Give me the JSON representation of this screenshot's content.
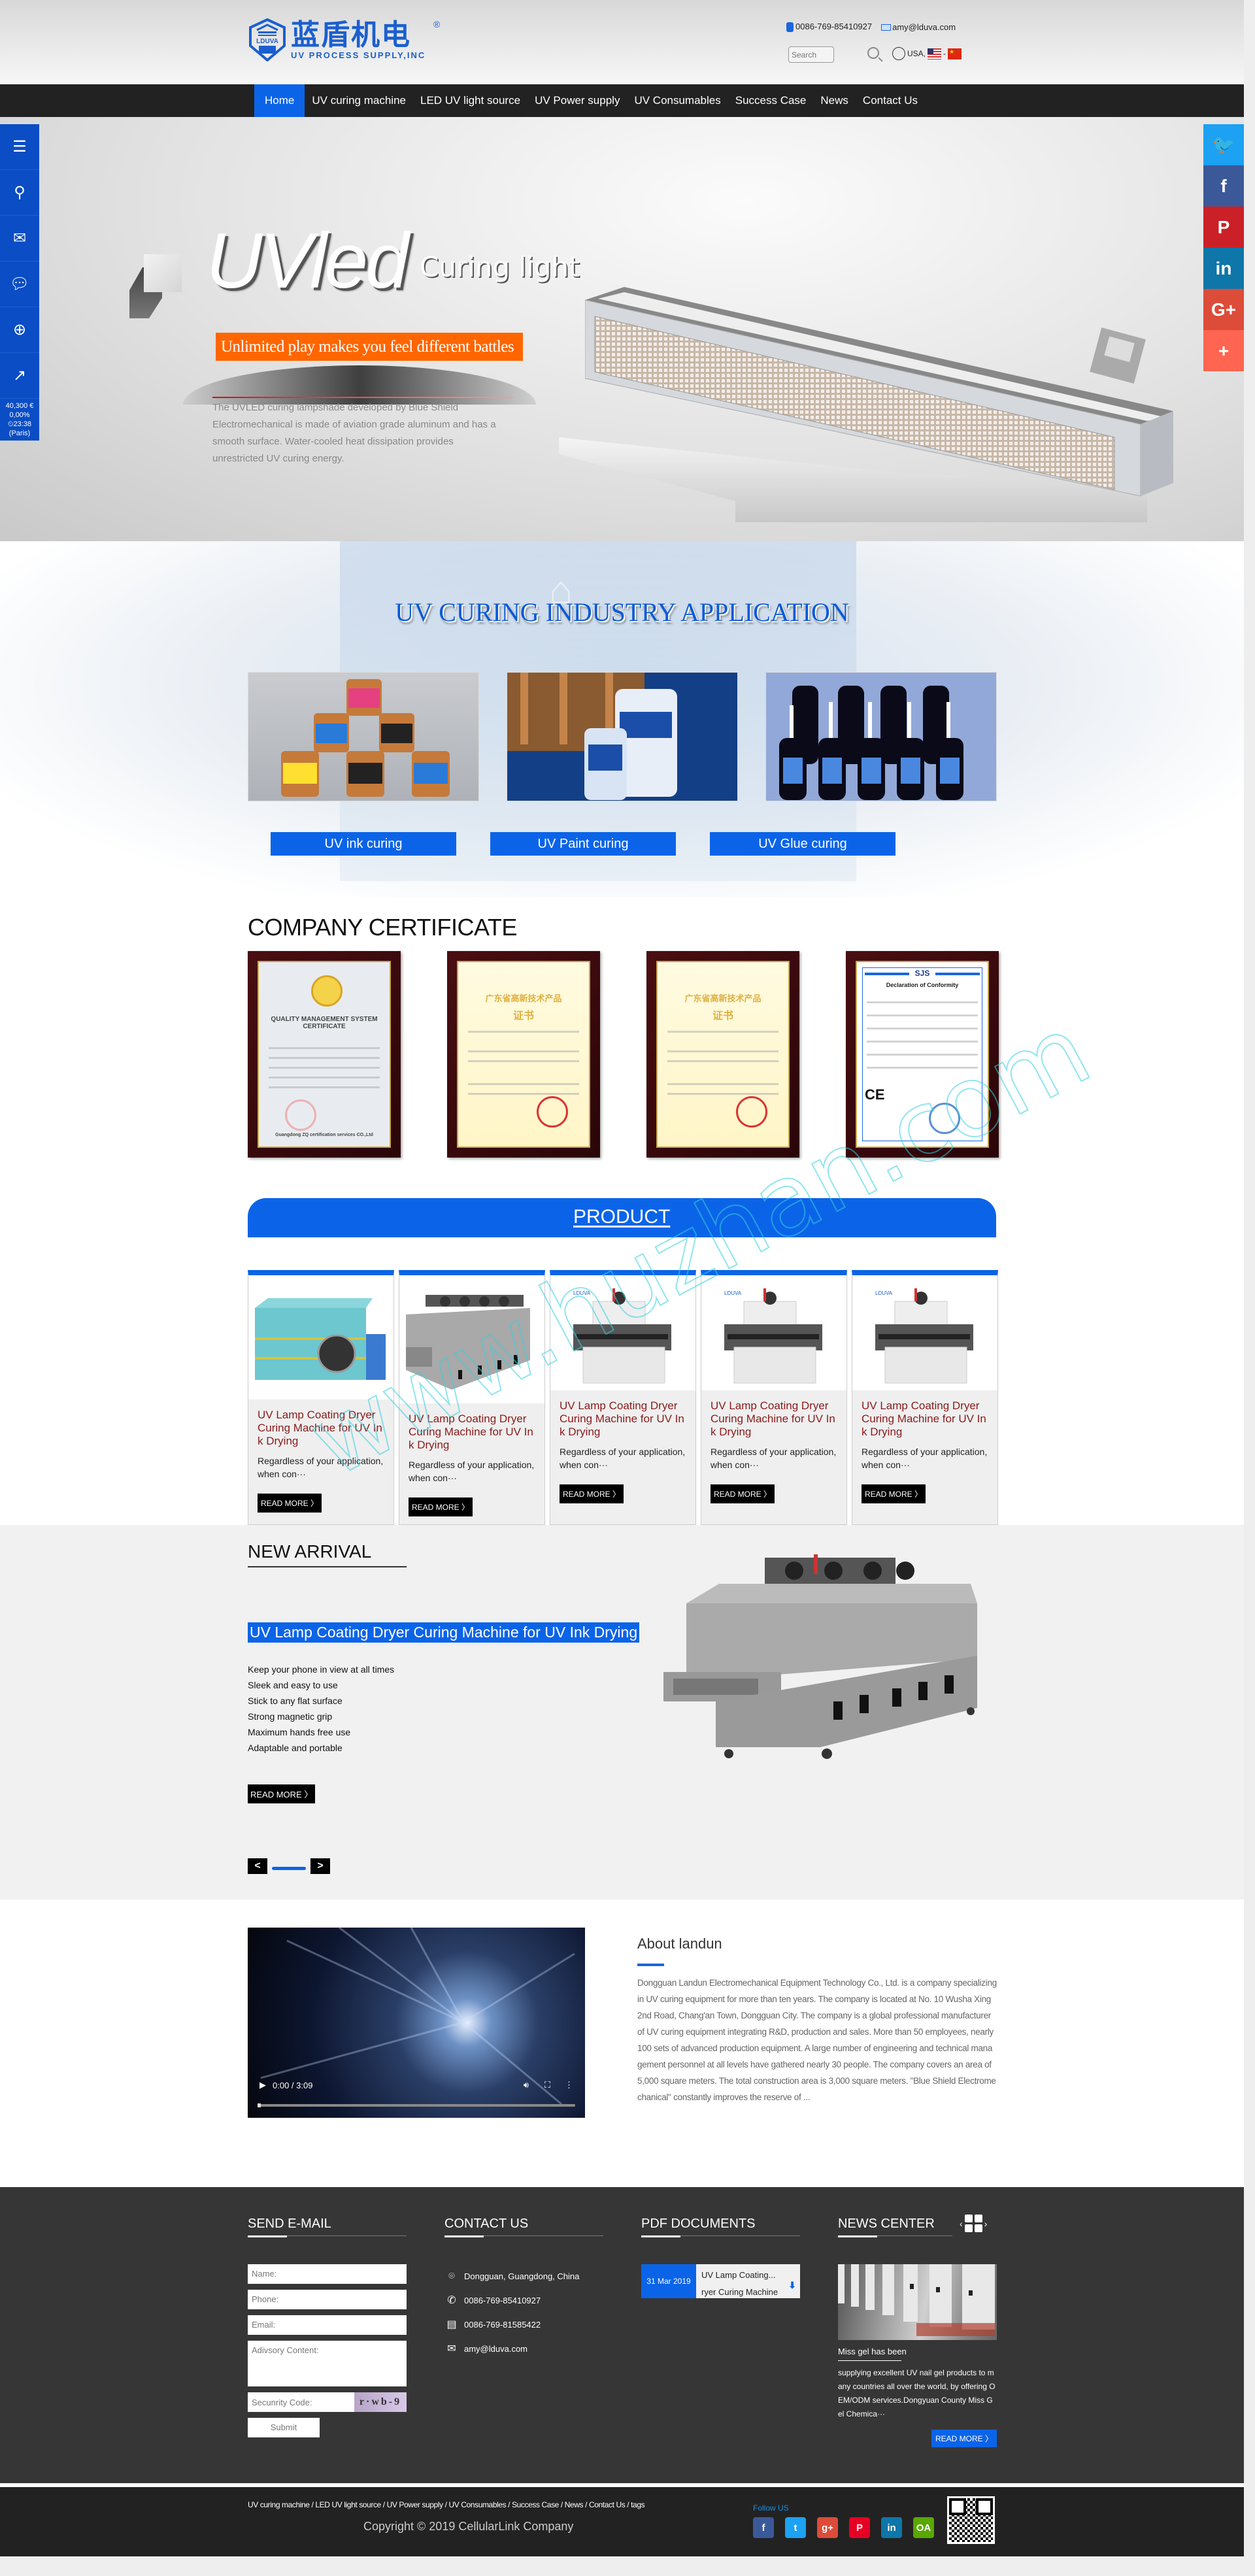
{
  "header": {
    "logo_cn": "蓝盾机电",
    "logo_en": "UV PROCESS SUPPLY,INC",
    "logo_badge": "LDUVA",
    "logo_badge_cn": "蓝盾",
    "reg_mark": "®",
    "phone": "0086-769-85410927",
    "email": "amy@lduva.com",
    "search_placeholder": "Search",
    "lang_label": "USA,",
    "lang_sep": "-"
  },
  "nav": {
    "items": [
      {
        "label": "Home",
        "active": true
      },
      {
        "label": "UV curing machine"
      },
      {
        "label": "LED UV light source"
      },
      {
        "label": "UV Power supply"
      },
      {
        "label": "UV Consumables"
      },
      {
        "label": "Success Case"
      },
      {
        "label": "News"
      },
      {
        "label": "Contact Us"
      }
    ]
  },
  "side_left": {
    "tools": [
      "menu-icon",
      "search-icon",
      "mail-icon",
      "chat-icon",
      "globe-icon",
      "chart-icon"
    ],
    "stock_price": "40,300 €",
    "stock_change": "0,00%",
    "stock_time": "⏲23:38",
    "stock_city": "(Paris)"
  },
  "side_right": {
    "items": [
      {
        "icon": "twitter-icon",
        "glyph": "🐦",
        "color": "#1da1f2"
      },
      {
        "icon": "facebook-icon",
        "glyph": "f",
        "color": "#3b5998"
      },
      {
        "icon": "pinterest-icon",
        "glyph": "P",
        "color": "#cb2027"
      },
      {
        "icon": "linkedin-icon",
        "glyph": "in",
        "color": "#0e76a8"
      },
      {
        "icon": "google-plus-icon",
        "glyph": "G+",
        "color": "#dd4b39"
      },
      {
        "icon": "share-plus-icon",
        "glyph": "+",
        "color": "#ff6550"
      }
    ]
  },
  "hero": {
    "big": "UVled",
    "small": "Curing light",
    "banner": "Unlimited play makes you feel different battles",
    "desc": "The UVLED curing lampshade developed by Blue Shield Electromechanical is made of aviation grade aluminum and has a smooth surface. Water-cooled heat dissipation provides unrestricted UV curing energy."
  },
  "application": {
    "title": "UV CURING INDUSTRY APPLICATION",
    "items": [
      {
        "label": "UV ink curing"
      },
      {
        "label": "UV Paint curing"
      },
      {
        "label": "UV Glue curing"
      }
    ]
  },
  "certificate": {
    "title": "COMPANY CERTIFICATE",
    "items": [
      {
        "heading": "QUALITY MANAGEMENT SYSTEM CERTIFICATE",
        "footer": "Guangdong ZQ certification services CO.,Ltd"
      },
      {
        "heading": "广东省高新技术产品",
        "sub": "证书"
      },
      {
        "heading": "广东省高新技术产品",
        "sub": "证书"
      },
      {
        "heading": "SJS",
        "sub": "Declaration of Conformity",
        "mark": "CE"
      }
    ]
  },
  "product": {
    "title": "PRODUCT",
    "items": [
      {
        "name": "UV Lamp Coating Dryer Curing Machine for UV Ink Drying",
        "desc": "Regardless of your application, when con···",
        "read_more": "READ MORE 〉"
      },
      {
        "name": "UV Lamp Coating Dryer Curing Machine for UV Ink Drying",
        "desc": "Regardless of your application, when con···",
        "read_more": "READ MORE 〉"
      },
      {
        "name": "UV Lamp Coating Dryer Curing Machine for UV Ink Drying",
        "desc": "Regardless of your application, when con···",
        "read_more": "READ MORE 〉"
      },
      {
        "name": "UV Lamp Coating Dryer Curing Machine for UV Ink Drying",
        "desc": "Regardless of your application, when con···",
        "read_more": "READ MORE 〉"
      },
      {
        "name": "UV Lamp Coating Dryer Curing Machine for UV Ink Drying",
        "desc": "Regardless of your application, when con···",
        "read_more": "READ MORE 〉"
      }
    ]
  },
  "arrival": {
    "heading": "NEW ARRIVAL",
    "title": "UV Lamp Coating Dryer Curing Machine for UV Ink Drying",
    "features": [
      "Keep your phone in view at all times",
      "Sleek and easy to use",
      "Stick to any flat surface",
      "Strong magnetic grip",
      "Maximum hands free use",
      "Adaptable and portable"
    ],
    "read_more": "READ MORE 〉",
    "prev": "<",
    "next": ">"
  },
  "about": {
    "video_time": "0:00 / 3:09",
    "heading": "About landun",
    "text": "Dongguan Landun Electromechanical Equipment Technology Co., Ltd. is a company specializing in UV curing equipment for more than ten years. The company is located at No. 10 Wusha Xing 2nd Road, Chang'an Town, Dongguan City. The company is a global professional manufacturer of UV curing equipment integrating R&D, production and sales. More than 50 employees, nearly 100 sets of advanced production equipment. A large number of engineering and technical management personnel at all levels have gathered nearly 30 people. The company covers an area of 5,000 square meters. The total construction area is 3,000 square meters. \"Blue Shield Electromechanical\" constantly improves the reserve of ..."
  },
  "footer": {
    "send_email": {
      "title": "SEND E-MAIL",
      "name_ph": "Name:",
      "phone_ph": "Phone:",
      "email_ph": "Email:",
      "content_ph": "Adivsory Content:",
      "code_ph": "Secunrity Code:",
      "captcha": "r·wb-9",
      "submit": "Submit"
    },
    "contact": {
      "title": "CONTACT US",
      "address": "Dongguan, Guangdong, China",
      "phone": "0086-769-85410927",
      "fax": "0086-769-81585422",
      "email": "amy@lduva.com"
    },
    "pdf": {
      "title": "PDF DOCUMENTS",
      "date": "31 Mar 2019",
      "name_line1": "UV Lamp Coating...",
      "name_line2": "ryer Curing Machine"
    },
    "news": {
      "title": "NEWS CENTER",
      "prev": "‹",
      "next": "›",
      "item_title": "Miss gel has been",
      "item_text": "supplying excellent UV nail gel products to many countries all over the world, by offering OEM/ODM services.Dongyuan County Miss Gel Chemica···",
      "read_more": "READ MORE 〉"
    }
  },
  "copyright": {
    "links": "UV curing machine / LED UV light source / UV Power supply / UV Consumables / Success Case / News / Contact Us / tags",
    "text": "Copyright © 2019 CellularLink Company",
    "follow": "Follow US",
    "social": [
      {
        "icon": "facebook-icon",
        "glyph": "f",
        "color": "#3b5998"
      },
      {
        "icon": "twitter-icon",
        "glyph": "t",
        "color": "#1da1f2"
      },
      {
        "icon": "google-plus-icon",
        "glyph": "g+",
        "color": "#dd4b39"
      },
      {
        "icon": "pinterest-icon",
        "glyph": "P",
        "color": "#e60023"
      },
      {
        "icon": "linkedin-icon",
        "glyph": "in",
        "color": "#0e76a8"
      },
      {
        "icon": "oa-icon",
        "glyph": "OA",
        "color": "#5aa700"
      }
    ]
  },
  "watermark": "www.huzhan.com"
}
